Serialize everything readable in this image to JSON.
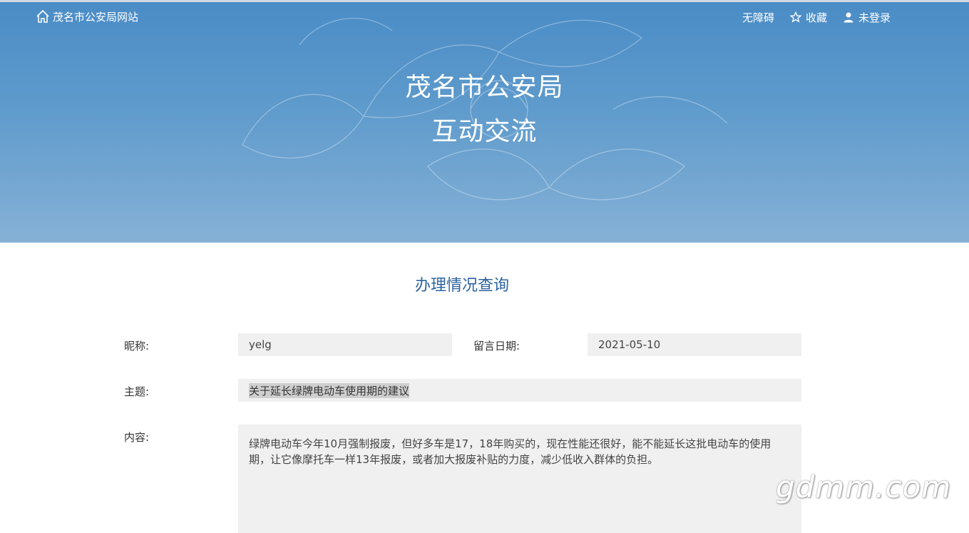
{
  "header": {
    "site_name": "茂名市公安局网站",
    "nav": {
      "accessibility": "无障碍",
      "favorite": "收藏",
      "login": "未登录"
    },
    "title_line1": "茂名市公安局",
    "title_line2": "互动交流"
  },
  "main": {
    "section_title": "办理情况查询",
    "fields": {
      "nickname_label": "昵称:",
      "nickname_value": "yelg",
      "date_label": "留言日期:",
      "date_value": "2021-05-10",
      "subject_label": "主题:",
      "subject_value": "关于延长绿牌电动车使用期的建议",
      "content_label": "内容:",
      "content_value": "绿牌电动车今年10月强制报废，但好多车是17，18年购买的，现在性能还很好，能不能延长这批电动车的使用期，让它像摩托车一样13年报废，或者加大报废补贴的力度，减少低收入群体的负担。"
    }
  },
  "watermark": "gdmm.com"
}
